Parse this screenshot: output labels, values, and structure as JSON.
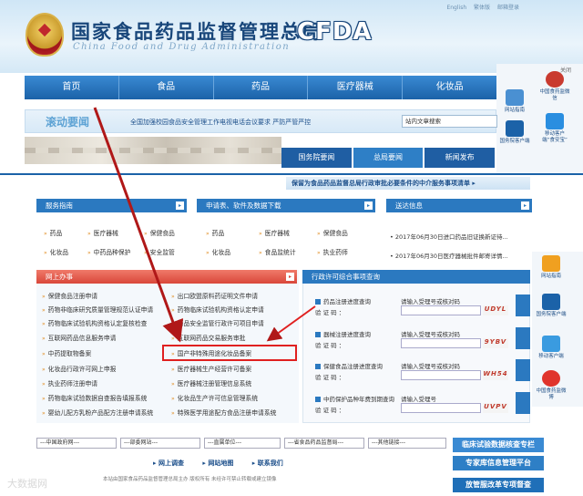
{
  "header": {
    "top_links": [
      "English",
      "繁体版",
      "邮箱登录"
    ],
    "title_cn": "国家食品药品监督管理总局",
    "title_en": "China Food and Drug Administration",
    "logo_text": "CFDA"
  },
  "nav": {
    "items": [
      "首页",
      "食品",
      "药品",
      "医疗器械",
      "化妆品"
    ]
  },
  "right_rail": {
    "close": "关闭",
    "items": [
      "网站指南",
      "中国食药监微信",
      "国务院客户端",
      "移动客户端“食安宝”",
      "网站指南",
      "国务院客户端",
      "移动客户端",
      "中国食药监微博"
    ]
  },
  "marquee": {
    "title": "滚动要闻",
    "text": "全国加强校园食品安全管理工作电视电话会议要求 严防严管严控",
    "search_placeholder": "站内文章搜索"
  },
  "tabs": [
    "国务院要闻",
    "总局要闻",
    "新闻发布"
  ],
  "notice": "保留为食品药品监督总局行政审批必要条件的中介服务事项清单 ▸",
  "service_guide": {
    "title": "服务指南",
    "items": [
      "药品",
      "医疗器械",
      "保健食品",
      "化妆品",
      "中药品种保护",
      "安全监管"
    ]
  },
  "downloads": {
    "title": "申请表、软件及数据下载",
    "items": [
      "药品",
      "医疗器械",
      "保健食品",
      "化妆品",
      "食品监统计",
      "执业药师"
    ]
  },
  "delivery": {
    "title": "送达信息",
    "items": [
      "• 2017年06月30日进口药品旧证换新证待...",
      "• 2017年06月30日医疗器械批件邮寄详情..."
    ]
  },
  "online": {
    "title": "网上办事",
    "left": [
      "保健食品注册申请",
      "药物非临床研究质量管理规范认证申请",
      "药物临床试验机构资格认定复核检查",
      "互联网药品信息服务申请",
      "中药提取物备案",
      "化妆品行政许可网上申报",
      "执业药师注册申请",
      "药物临床试验数据自查报告填报系统",
      "婴幼儿配方乳粉产品配方注册申请系统"
    ],
    "right": [
      "出口欧盟原料药证明文件申请",
      "药物临床试验机构资格认定申请",
      "药品安全监管行政许可项目申请",
      "互联网药品交易服务审批",
      "国产非特殊用途化妆品备案",
      "医疗器械生产经营许可备案",
      "医疗器械注册管理信息系统",
      "化妆品生产许可信息管理系统",
      "特殊医学用途配方食品注册申请系统"
    ]
  },
  "query": {
    "title": "行政许可综合事项查询",
    "items": [
      {
        "label": "药品注册进度查询",
        "hint": "请输入受理号或核对码",
        "sub": "验 证 码 ：",
        "code": "UDYL"
      },
      {
        "label": "器械注册进度查询",
        "hint": "请输入受理号或核对码",
        "sub": "验 证 码 ：",
        "code": "9YBV"
      },
      {
        "label": "保健食品注册进度查询",
        "hint": "请输入受理号或核对码",
        "sub": "验 证 码 ：",
        "code": "WH54"
      },
      {
        "label": "中药保护品种年费到期查询",
        "hint": "请输入受理号",
        "sub": "验 证 码 ：",
        "code": "UVPV"
      }
    ]
  },
  "footer": {
    "selects": [
      "---中国政府网---",
      "---部委网站---",
      "---直属单位---",
      "---省食品药品监督局---",
      "---其他链接---"
    ],
    "buttons": [
      "临床试验数据核查专栏",
      "专家库信息管理平台",
      "放管服改革专项督查"
    ],
    "links": [
      "网上调查",
      "网站地图",
      "联系我们"
    ],
    "copyright": "本站由国家食品药品监督管理总局主办 版权所有 未经许可禁止转载或建立镜像",
    "watermark": "大数据网"
  },
  "colors": {
    "primary": "#1b62a8",
    "accent_red": "#e02020",
    "section_red": "#d9473a"
  }
}
